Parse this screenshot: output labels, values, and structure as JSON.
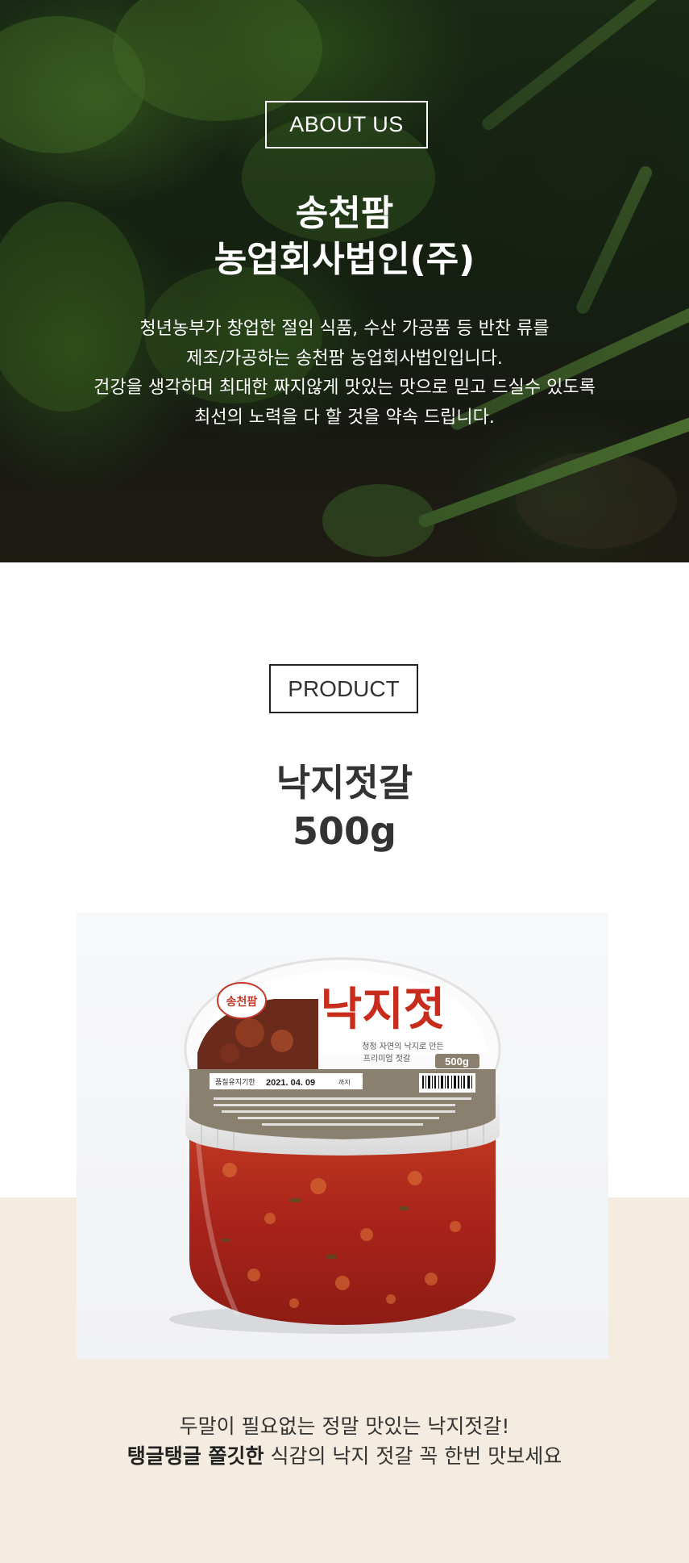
{
  "about": {
    "badge": "ABOUT US",
    "title_line1": "송천팜",
    "title_line2": "농업회사법인(주)",
    "description": [
      "청년농부가 창업한 절임 식품, 수산 가공품 등 반찬 류를",
      "제조/가공하는 송천팜 농업회사법인입니다.",
      "건강을 생각하며 최대한 짜지않게 맛있는 맛으로 믿고 드실수 있도록",
      "최선의 노력을 다 할 것을 약속 드립니다."
    ]
  },
  "product": {
    "badge": "PRODUCT",
    "name_line1": "낙지젓갈",
    "name_line2": "500g",
    "label": {
      "brand": "송천팜",
      "title": "낙지젓",
      "tagline_line1": "청정 자연의 낙지로 만든",
      "tagline_line2": "프리미엄 젓갈",
      "weight": "500g",
      "expiry_label": "품질유지기한",
      "expiry_date": "2021. 04. 09",
      "expiry_suffix": "까지"
    },
    "caption_line1": "두말이 필요없는 정말 맛있는 낙지젓갈!",
    "caption_bold": "탱글탱글 쫄깃한",
    "caption_rest": " 식감의 낙지 젓갈 꼭 한번 맛보세요"
  },
  "colors": {
    "beige_band": "#f4ece0",
    "label_taupe": "#8a8070",
    "sauce_red": "#b32a1a"
  }
}
